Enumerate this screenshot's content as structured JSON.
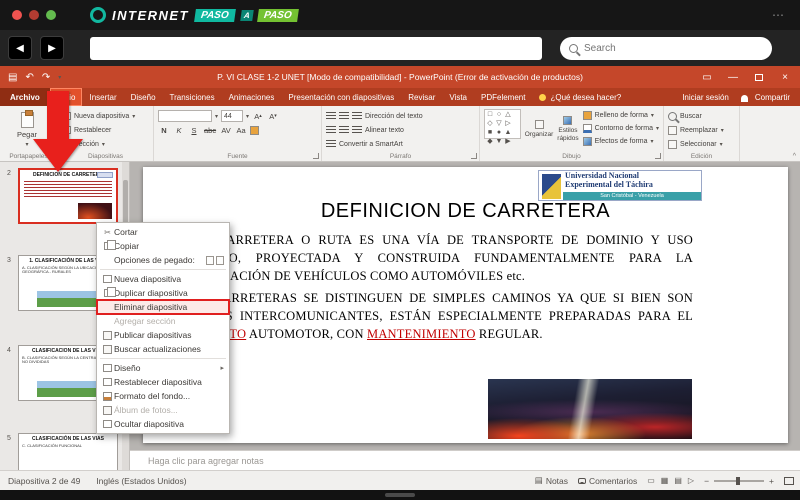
{
  "icons": {
    "back": "◀",
    "forward": "▶",
    "caret_down": "▾",
    "submenu_arrow": "▸",
    "close": "×",
    "minimize": "—",
    "save": "▤",
    "undo": "↶",
    "redo": "↷",
    "scissors": "✂",
    "bullet": "•",
    "view_normal": "▭",
    "view_sorter": "▦",
    "view_reading": "▤",
    "view_slideshow": "▷",
    "zoom_out": "−",
    "zoom_in": "+",
    "collapse_ribbon": "^",
    "ellipsis": "⋯"
  },
  "site_header": {
    "brand_word": "INTERNET",
    "brand_tag1": "PASO",
    "brand_tag2": "A",
    "brand_tag3": "PASO",
    "search_placeholder": "Search"
  },
  "window": {
    "title": "P. VI CLASE 1-2 UNET [Modo de compatibilidad] - PowerPoint (Error de activación de productos)"
  },
  "tabs": {
    "file": "Archivo",
    "items": [
      "Inicio",
      "Insertar",
      "Diseño",
      "Transiciones",
      "Animaciones",
      "Presentación con diapositivas",
      "Revisar",
      "Vista",
      "PDFelement"
    ],
    "tell_me": "¿Qué desea hacer?",
    "sign_in": "Iniciar sesión",
    "share": "Compartir"
  },
  "ribbon": {
    "clipboard": {
      "label": "Portapapeles",
      "paste": "Pegar"
    },
    "slides": {
      "label": "Diapositivas",
      "new_slide": "Nueva diapositiva",
      "reset": "Restablecer",
      "section": "Sección"
    },
    "font": {
      "label": "Fuente",
      "size": "44",
      "grow": "A",
      "shrink": "A",
      "styles": [
        "N",
        "K",
        "S",
        "abc",
        "AV",
        "Aa"
      ]
    },
    "paragraph": {
      "label": "Párrafo",
      "direction": "Dirección del texto",
      "align": "Alinear texto",
      "smartart": "Convertir a SmartArt"
    },
    "drawing": {
      "label": "Dibujo",
      "shapes": [
        "□",
        "○",
        "△",
        "◇",
        "▽",
        "▷",
        "■",
        "●",
        "▲",
        "◆",
        "▼",
        "▶"
      ],
      "arrange": "Organizar",
      "quick_styles": "Estilos rápidos",
      "fill": "Relleno de forma",
      "outline": "Contorno de forma",
      "effects": "Efectos de forma"
    },
    "editing": {
      "label": "Edición",
      "find": "Buscar",
      "replace": "Reemplazar",
      "select": "Seleccionar"
    }
  },
  "context_menu": {
    "items": [
      {
        "label": "Cortar"
      },
      {
        "label": "Copiar"
      },
      {
        "label": "Opciones de pegado:"
      },
      {
        "label": "Nueva diapositiva"
      },
      {
        "label": "Duplicar diapositiva"
      },
      {
        "label": "Eliminar diapositiva"
      },
      {
        "label": "Agregar sección"
      },
      {
        "label": "Publicar diapositivas"
      },
      {
        "label": "Buscar actualizaciones"
      },
      {
        "label": "Diseño"
      },
      {
        "label": "Restablecer diapositiva"
      },
      {
        "label": "Formato del fondo..."
      },
      {
        "label": "Álbum de fotos..."
      },
      {
        "label": "Ocultar diapositiva"
      }
    ]
  },
  "slides_panel": {
    "thumbnails": [
      {
        "number": "2",
        "title": "DEFINICION DE CARRETERA"
      },
      {
        "number": "3",
        "title": "1. CLASIFICACIÓN DE LAS VIAS",
        "sub": "A. CLASIFICACIÓN SEGÚN LA UBICACIÓN GEOGRÁFICA - RURALES"
      },
      {
        "number": "4",
        "title": "CLASIFICACION DE LAS VIAS",
        "sub": "B. CLASIFICACIÓN SEGÚN LA CENTRAL - VIAS NO DIVIDIDAS"
      },
      {
        "number": "5",
        "title": "CLASIFICACIÓN DE LAS VIAS",
        "sub": "C. CLASIFICACIÓN FUNCIONAL"
      }
    ]
  },
  "slide": {
    "title": "DEFINICION DE CARRETERA",
    "logo": {
      "line1": "Universidad Nacional",
      "line2": "Experimental del Táchira",
      "line3": "San Cristóbal - Venezuela"
    },
    "bullet1": "UNA CARRETERA O RUTA ES UNA VÍA DE TRANSPORTE DE DOMINIO Y USO PÚBLICO, PROYECTADA Y CONSTRUIDA FUNDAMENTALMENTE PARA LA CIRCULACIÓN DE VEHÍCULOS COMO AUTOMÓVILES etc.",
    "bullet2": {
      "part1": "LAS CARRETERAS SE DISTINGUEN DE SIMPLES CAMINOS YA QUE SI BIEN SON SENDAS INTERCOMUNICANTES, ESTÁN ESPECIALMENTE PREPARADAS PARA EL ",
      "link1": "TRÁNSITO",
      "part2": " AUTOMOTOR, CON ",
      "link2": "MANTENIMIENTO",
      "part3": " REGULAR."
    }
  },
  "notes": {
    "placeholder": "Haga clic para agregar notas"
  },
  "status_bar": {
    "slide_counter": "Diapositiva 2 de 49",
    "language": "Inglés (Estados Unidos)",
    "notes": "Notas",
    "comments": "Comentarios"
  }
}
